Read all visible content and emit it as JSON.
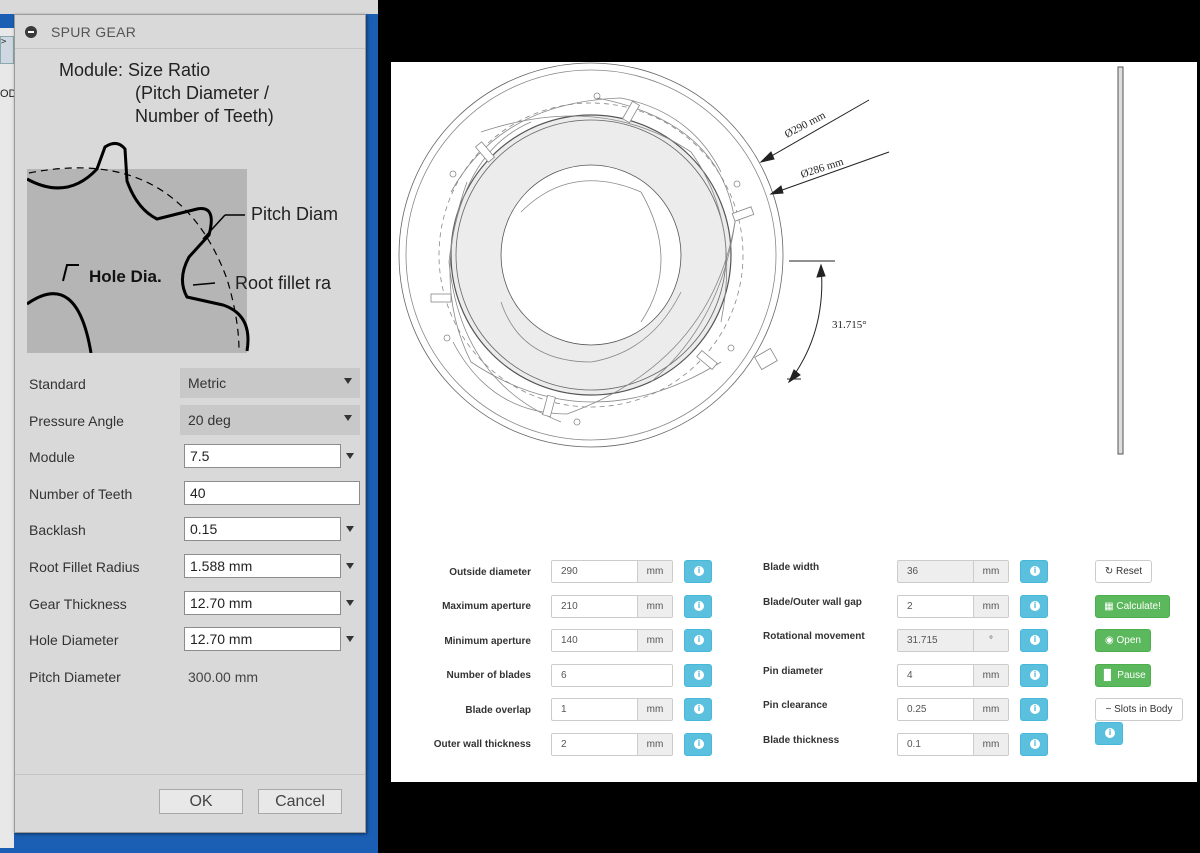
{
  "background": {
    "left_tool_text": "OD"
  },
  "dialog": {
    "title": "SPUR GEAR",
    "caption_line1": "Module: Size Ratio",
    "caption_line2": "(Pitch Diameter /",
    "caption_line3": "Number of Teeth)",
    "figure_labels": {
      "pitch": "Pitch Diam",
      "hole": "Hole Dia.",
      "root": "Root fillet ra"
    },
    "fields": {
      "standard": {
        "label": "Standard",
        "value": "Metric"
      },
      "pressure_angle": {
        "label": "Pressure Angle",
        "value": "20 deg"
      },
      "module": {
        "label": "Module",
        "value": "7.5"
      },
      "teeth": {
        "label": "Number of Teeth",
        "value": "40"
      },
      "backlash": {
        "label": "Backlash",
        "value": "0.15"
      },
      "root_fillet": {
        "label": "Root Fillet Radius",
        "value": "1.588 mm"
      },
      "gear_thickness": {
        "label": "Gear Thickness",
        "value": "12.70 mm"
      },
      "hole_diameter": {
        "label": "Hole Diameter",
        "value": "12.70 mm"
      },
      "pitch_diameter": {
        "label": "Pitch Diameter",
        "value": "300.00 mm"
      }
    },
    "ok_label": "OK",
    "cancel_label": "Cancel"
  },
  "drawing": {
    "dim_outer": "Ø290 mm",
    "dim_inner": "Ø286 mm",
    "dim_angle": "31.715°"
  },
  "form": {
    "outside_diameter": {
      "label": "Outside diameter",
      "value": "290",
      "unit": "mm"
    },
    "max_aperture": {
      "label": "Maximum aperture",
      "value": "210",
      "unit": "mm"
    },
    "min_aperture": {
      "label": "Minimum aperture",
      "value": "140",
      "unit": "mm"
    },
    "num_blades": {
      "label": "Number of blades",
      "value": "6"
    },
    "blade_overlap": {
      "label": "Blade overlap",
      "value": "1",
      "unit": "mm"
    },
    "outer_wall": {
      "label": "Outer wall thickness",
      "value": "2",
      "unit": "mm"
    },
    "blade_width": {
      "label": "Blade width",
      "value": "36",
      "unit": "mm"
    },
    "wall_gap": {
      "label": "Blade/Outer wall gap",
      "value": "2",
      "unit": "mm"
    },
    "rot_movement": {
      "label": "Rotational movement",
      "value": "31.715",
      "unit": "°"
    },
    "pin_diameter": {
      "label": "Pin diameter",
      "value": "4",
      "unit": "mm"
    },
    "pin_clearance": {
      "label": "Pin clearance",
      "value": "0.25",
      "unit": "mm"
    },
    "blade_thickness": {
      "label": "Blade thickness",
      "value": "0.1",
      "unit": "mm"
    }
  },
  "actions": {
    "reset": "Reset",
    "calculate": "Calculate!",
    "open": "Open",
    "pause": "Pause",
    "slots": "Slots in Body"
  },
  "colors": {
    "dialog_bg": "#d9d9d9",
    "info_button": "#5bc0de",
    "success_button": "#5cb85c",
    "desktop_blue": "#1a5fb4"
  }
}
